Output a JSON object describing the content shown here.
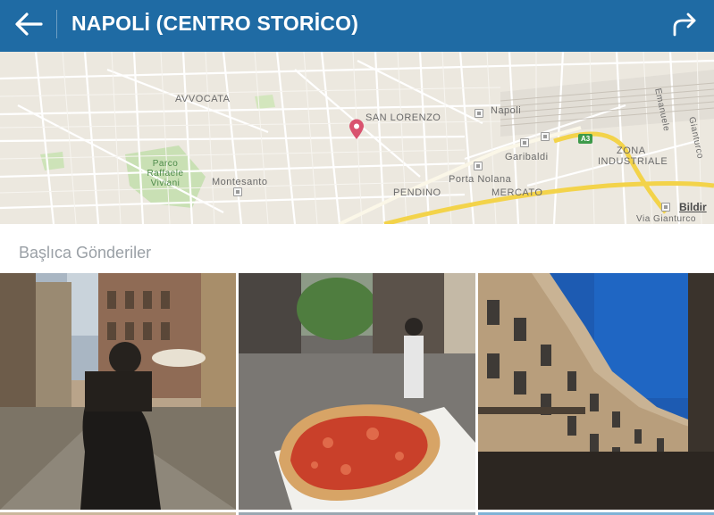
{
  "header": {
    "title": "NAPOLİ (CENTRO STORİCO)",
    "back_icon": "arrow-left-icon",
    "share_icon": "share-arrow-icon"
  },
  "map": {
    "labels": {
      "avvocata": "AVVOCATA",
      "san_lorenzo": "SAN LORENZO",
      "napoli": "Napoli",
      "garibaldi": "Garibaldi",
      "porta_nolana": "Porta Nolana",
      "pendino": "PENDINO",
      "mercato": "MERCATO",
      "montesanto": "Montesanto",
      "zona_industriale_1": "ZONA",
      "zona_industriale_2": "INDUSTRIALE",
      "parco": "Parco Raffaele Viviani",
      "emanuele": "Emanuele",
      "gianturco": "Gianturco",
      "via_gianturco": "Via Gianturco",
      "highway": "A3"
    },
    "report_link": "Bildir"
  },
  "section": {
    "title": "Başlıca Gönderiler"
  },
  "colors": {
    "header_bg": "#1f6ba4",
    "map_bg": "#ece8df",
    "pin": "#d9536f",
    "highway": "#f3d34a"
  }
}
